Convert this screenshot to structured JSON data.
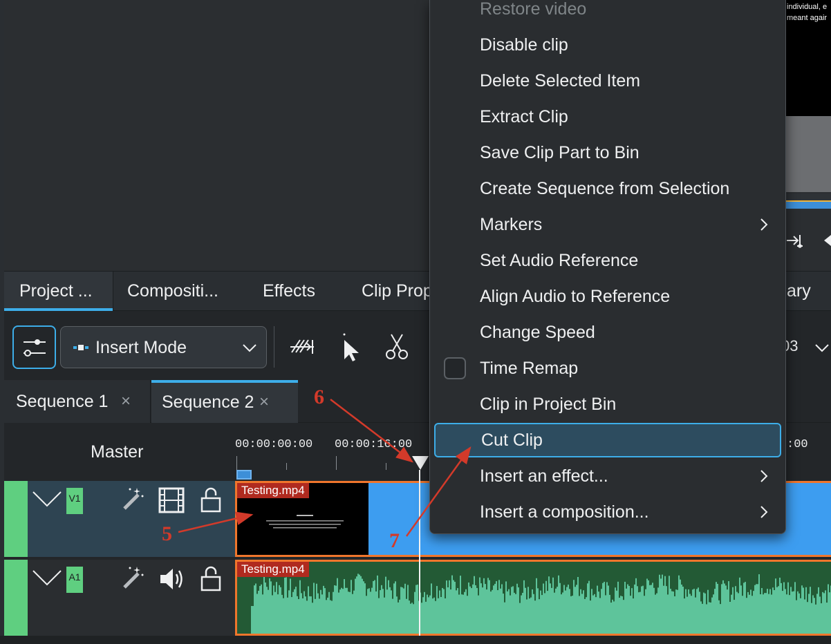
{
  "project_monitor": {
    "overlay_text_line1": "individual, e",
    "overlay_text_line2": "meant agair",
    "goto_icon": "goto-end-icon",
    "play_icon": "play-reverse-icon"
  },
  "dock_tabs": [
    {
      "label": "Project ..."
    },
    {
      "label": "Compositi..."
    },
    {
      "label": "Effects"
    },
    {
      "label": "Clip Prop"
    },
    {
      "label": "ary"
    }
  ],
  "toolbar": {
    "mode_label": "Insert Mode",
    "zoom_value": "03",
    "icons": [
      "timeline-settings-icon",
      "insert-mode-icon",
      "chevron-down-icon",
      "spacer-tool-icon",
      "select-tool-icon",
      "razor-tool-icon"
    ]
  },
  "sequence_tabs": [
    {
      "label": "Sequence 1",
      "close": "×"
    },
    {
      "label": "Sequence 2",
      "close": "×"
    }
  ],
  "timeline": {
    "master_label": "Master",
    "ruler_labels": [
      "00:00:00:00",
      "00:00:16:00",
      ":00"
    ],
    "tracks": [
      {
        "name": "V1",
        "type_icon": "film-icon",
        "clip_name": "Testing.mp4"
      },
      {
        "name": "A1",
        "type_icon": "speaker-icon",
        "clip_name": "Testing.mp4"
      }
    ]
  },
  "context_menu": {
    "items": [
      {
        "label": "Restore video",
        "disabled": true
      },
      {
        "label": "Disable clip"
      },
      {
        "label": "Delete Selected Item"
      },
      {
        "label": "Extract Clip"
      },
      {
        "label": "Save Clip Part to Bin"
      },
      {
        "label": "Create Sequence from Selection"
      },
      {
        "label": "Markers",
        "submenu": true
      },
      {
        "label": "Set Audio Reference"
      },
      {
        "label": "Align Audio to Reference"
      },
      {
        "label": "Change Speed"
      },
      {
        "label": "Time Remap",
        "checkbox": true
      },
      {
        "label": "Clip in Project Bin"
      },
      {
        "label": "Cut Clip",
        "highlighted": true
      },
      {
        "label": "Insert an effect...",
        "submenu": true
      },
      {
        "label": "Insert a composition...",
        "submenu": true
      }
    ]
  },
  "annotations": {
    "five": "5",
    "six": "6",
    "seven": "7"
  },
  "colors": {
    "accent": "#3daee9",
    "clip_border": "#f0762c",
    "clip_label_bg": "#b02a1f",
    "video_clip": "#3d9df0",
    "audio_wave": "#5ec49b",
    "track_tag": "#5fcf80",
    "annotation": "#d33a2a"
  }
}
